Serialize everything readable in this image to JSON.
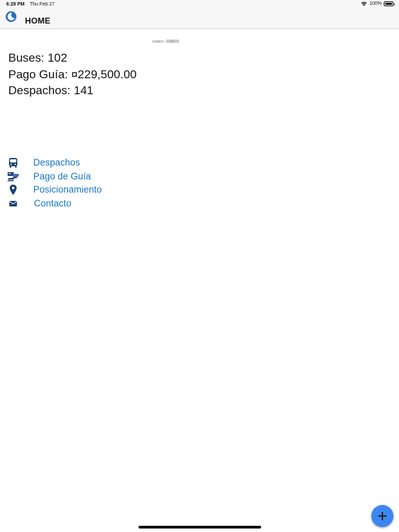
{
  "status_bar": {
    "time": "6:28 PM",
    "date": "Thu Feb 27",
    "battery": "100%",
    "icons": [
      "wifi-icon",
      "battery-icon"
    ]
  },
  "navbar": {
    "title": "HOME",
    "logo_icon": "app-logo-icon"
  },
  "stats": {
    "buses": "Buses: 102",
    "pago_guia": "Pago Guía: ¤229,500.00",
    "despachos": "Despachos: 141"
  },
  "menu": {
    "items": [
      {
        "label": "Despachos",
        "icon": "bus-icon"
      },
      {
        "label": "Pago de Guía",
        "icon": "payment-icon"
      },
      {
        "label": "Posicionamiento",
        "icon": "location-pin-icon"
      },
      {
        "label": "Contacto",
        "icon": "envelope-icon"
      }
    ]
  },
  "fab": {
    "icon": "plus-icon"
  },
  "colors": {
    "link": "#1476c6",
    "icon": "#1c3f73",
    "fab": "#3d86f1",
    "bar_bg": "#f7f7f7"
  }
}
